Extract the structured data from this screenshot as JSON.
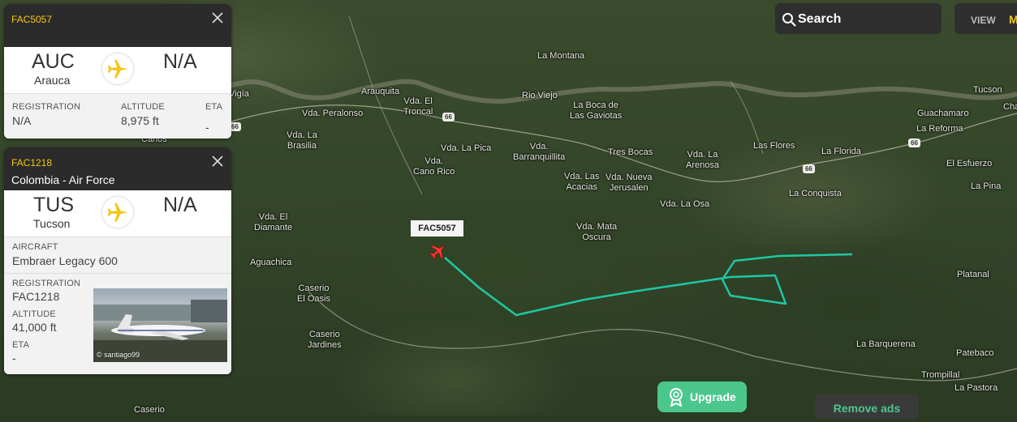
{
  "map": {
    "places": [
      {
        "id": "vigia",
        "text": "Vigía"
      },
      {
        "id": "canos",
        "text": "Canos"
      },
      {
        "id": "peralonso",
        "text": "Vda. Peralonso"
      },
      {
        "id": "arauquita",
        "text": "Arauquita"
      },
      {
        "id": "troncal",
        "text": "Vda. El\nTroncal"
      },
      {
        "id": "labrasilia",
        "text": "Vda. La\nBrasilia"
      },
      {
        "id": "lamontana",
        "text": "La Montana"
      },
      {
        "id": "rioviejo",
        "text": "Rio Viejo"
      },
      {
        "id": "bocagaviotas",
        "text": "La Boca de\nLas Gaviotas"
      },
      {
        "id": "lapica",
        "text": "Vda. La Pica"
      },
      {
        "id": "barranquillita",
        "text": "Vda.\nBarranquillita"
      },
      {
        "id": "tresbocas",
        "text": "Tres Bocas"
      },
      {
        "id": "laarenosa",
        "text": "Vda. La\nArenosa"
      },
      {
        "id": "lasflores",
        "text": "Las Flores"
      },
      {
        "id": "laflorida",
        "text": "La Florida"
      },
      {
        "id": "guachamaro",
        "text": "Guachamaro"
      },
      {
        "id": "lareforma",
        "text": "La Reforma"
      },
      {
        "id": "elesfuerzo",
        "text": "El Esfuerzo"
      },
      {
        "id": "lapina",
        "text": "La Pina"
      },
      {
        "id": "tucson",
        "text": "Tucson"
      },
      {
        "id": "cha",
        "text": "Cha"
      },
      {
        "id": "canorico",
        "text": "Vda.\nCano Rico"
      },
      {
        "id": "lasacacias",
        "text": "Vda. Las\nAcacias"
      },
      {
        "id": "nuevajerusalen",
        "text": "Vda. Nueva\nJerusalen"
      },
      {
        "id": "laosa",
        "text": "Vda. La Osa"
      },
      {
        "id": "laconquista",
        "text": "La Conquista"
      },
      {
        "id": "eldiamante",
        "text": "Vda. El\nDiamante"
      },
      {
        "id": "mataoscura",
        "text": "Vda. Mata\nOscura"
      },
      {
        "id": "aguachica",
        "text": "Aguachica"
      },
      {
        "id": "caserioeloasis",
        "text": "Caserio\nEl Oasis"
      },
      {
        "id": "caseriojardines",
        "text": "Caserio\nJardines"
      },
      {
        "id": "platanal",
        "text": "Platanal"
      },
      {
        "id": "labarquerena",
        "text": "La Barquerena"
      },
      {
        "id": "patebaco",
        "text": "Patebaco"
      },
      {
        "id": "trompillal",
        "text": "Trompillal"
      },
      {
        "id": "lapastora",
        "text": "La Pastora"
      },
      {
        "id": "caserio2",
        "text": "Caserio"
      }
    ],
    "road_number": "66",
    "flight_label": "FAC5057"
  },
  "topbar": {
    "search_label": "Search",
    "view_label": "VIEW",
    "view_mode_initial": "M"
  },
  "card1": {
    "callsign": "FAC5057",
    "origin_code": "AUC",
    "origin_city": "Arauca",
    "dest_code": "N/A",
    "registration_label": "REGISTRATION",
    "registration": "N/A",
    "altitude_label": "ALTITUDE",
    "altitude": "8,975 ft",
    "eta_label": "ETA",
    "eta": "-"
  },
  "card2": {
    "callsign": "FAC1218",
    "airline": "Colombia - Air Force",
    "origin_code": "TUS",
    "origin_city": "Tucson",
    "dest_code": "N/A",
    "aircraft_label": "AIRCRAFT",
    "aircraft": "Embraer Legacy 600",
    "registration_label": "REGISTRATION",
    "registration": "FAC1218",
    "altitude_label": "ALTITUDE",
    "altitude": "41,000 ft",
    "eta_label": "ETA",
    "eta": "-",
    "photo_credit": "© santiago99"
  },
  "buttons": {
    "upgrade": "Upgrade",
    "remove_ads": "Remove ads"
  },
  "colors": {
    "track": "#1fc8a4",
    "accent": "#f5c518",
    "upgrade": "#4bc78c"
  },
  "icons": [
    "search-icon",
    "close-icon",
    "airplane-icon",
    "aircraft-marker-icon",
    "award-icon"
  ]
}
